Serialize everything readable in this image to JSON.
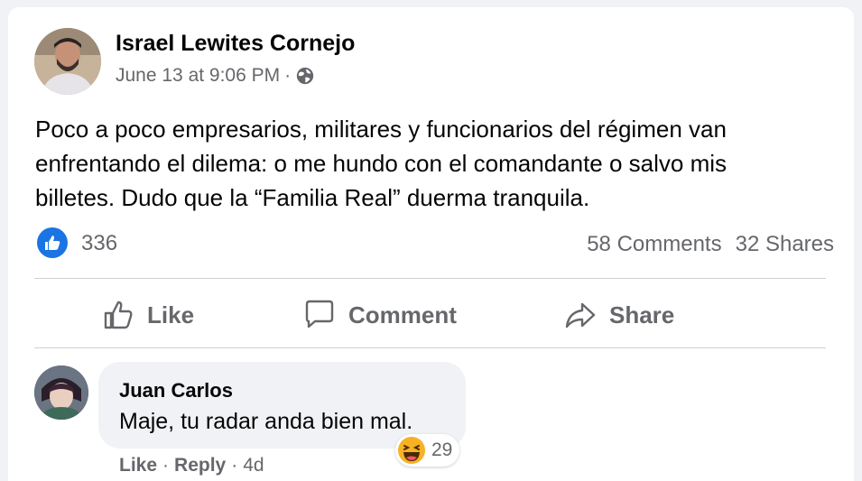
{
  "post": {
    "author": "Israel Lewites Cornejo",
    "timestamp": "June 13 at 9:06 PM",
    "separator": "·",
    "audience_icon": "globe-icon",
    "text_lines": [
      "Poco a poco empresarios, militares y funcionarios del régimen van",
      "enfrentando el dilema: o me hundo con el comandante o salvo mis",
      "billetes. Dudo que la “Familia Real” duerma tranquila."
    ],
    "reaction_count": "336",
    "comments_count": "58 Comments",
    "shares_count": "32 Shares"
  },
  "actions": {
    "like": "Like",
    "comment": "Comment",
    "share": "Share"
  },
  "comment": {
    "author": "Juan Carlos",
    "text": "Maje, tu radar anda bien mal.",
    "reaction_count": "29",
    "reaction_icon": "haha-emoji-icon",
    "like_label": "Like",
    "reply_label": "Reply",
    "separator": "·",
    "age": "4d"
  },
  "colors": {
    "accent_blue": "#1b74e4",
    "secondary_text": "#65676b",
    "bubble_bg": "#f0f2f5"
  }
}
